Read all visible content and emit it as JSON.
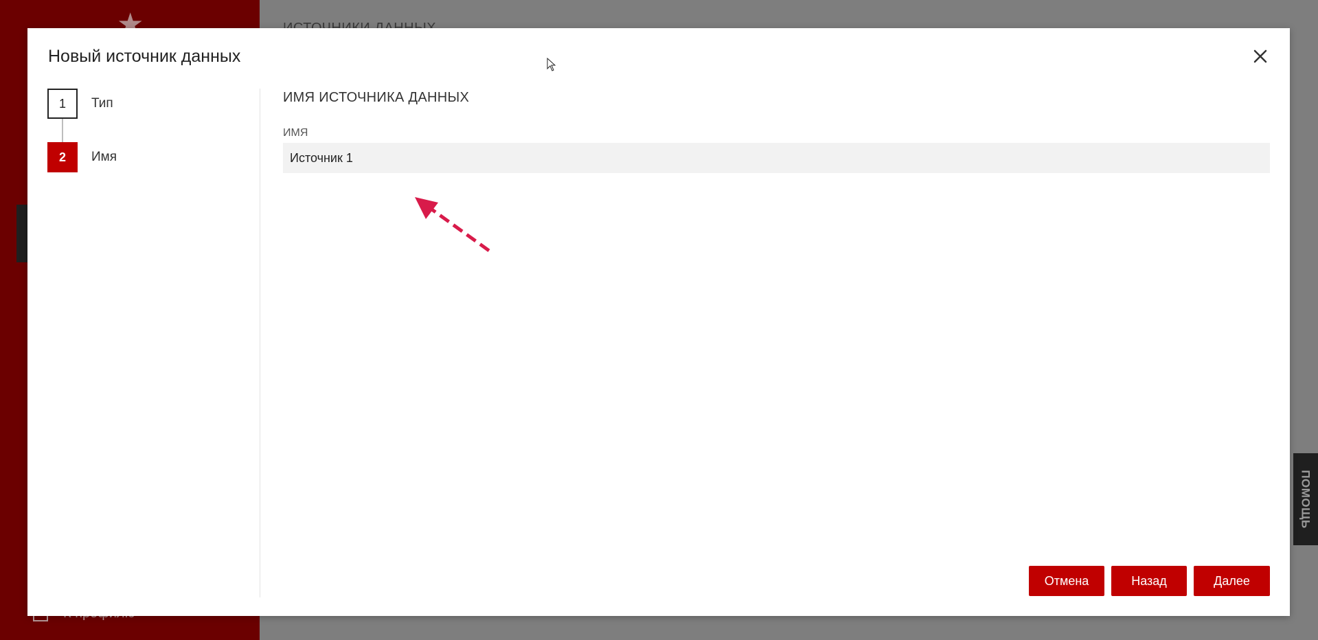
{
  "background": {
    "header_text": "ИСТОЧНИКИ ДАННЫХ",
    "profile_link": "К профилю",
    "help_tab": "ПОМОЩЬ"
  },
  "modal": {
    "title": "Новый источник данных",
    "steps": [
      {
        "number": "1",
        "label": "Тип",
        "state": "done"
      },
      {
        "number": "2",
        "label": "Имя",
        "state": "active"
      }
    ],
    "section_title": "ИМЯ ИСТОЧНИКА ДАННЫХ",
    "name_field": {
      "label": "ИМЯ",
      "value": "Источник 1"
    },
    "buttons": {
      "cancel": "Отмена",
      "back": "Назад",
      "next": "Далее"
    }
  },
  "colors": {
    "accent": "#c00000",
    "sidebar_dimmed": "#6b0000",
    "overlay": "#7e7e7e",
    "annotation_arrow": "#d81b4a"
  },
  "icons": [
    "star-icon",
    "close-icon",
    "exit-icon",
    "cursor-icon",
    "annotation-arrow-icon"
  ]
}
